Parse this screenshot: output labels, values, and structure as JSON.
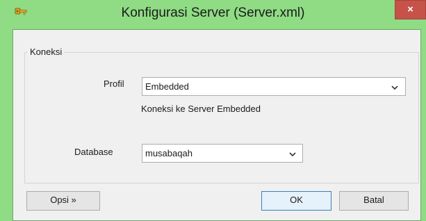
{
  "window": {
    "title": "Konfigurasi Server (Server.xml)",
    "close_symbol": "×",
    "app_icon": "key-icon",
    "titlebar_color": "#8fdc84",
    "close_color": "#c6524a"
  },
  "group": {
    "legend": "Koneksi"
  },
  "form": {
    "profil_label": "Profil",
    "profil_value": "Embedded",
    "profil_description": "Koneksi ke Server Embedded",
    "database_label": "Database",
    "database_value": "musabaqah"
  },
  "buttons": {
    "options": "Opsi »",
    "ok": "OK",
    "cancel": "Batal"
  }
}
